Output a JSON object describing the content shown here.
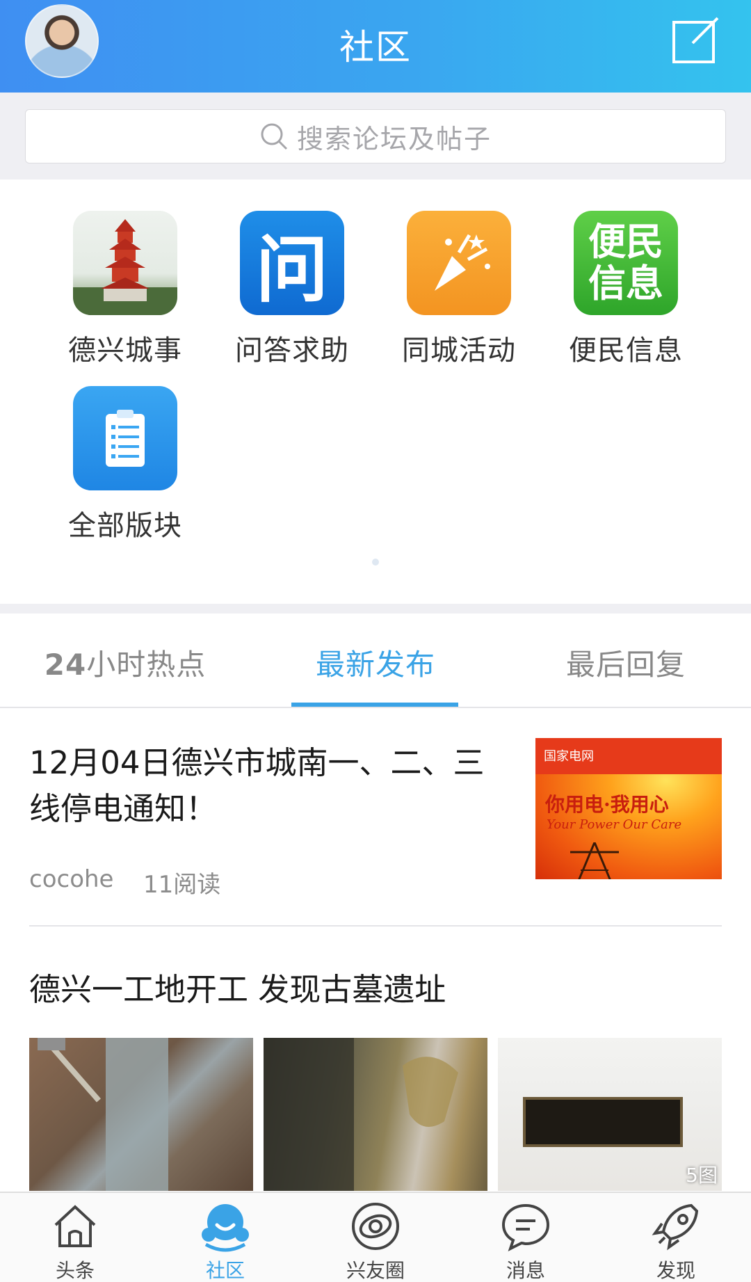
{
  "header": {
    "title": "社区"
  },
  "search": {
    "placeholder": "搜索论坛及帖子"
  },
  "categories": [
    {
      "label": "德兴城事",
      "icon": "pagoda-icon"
    },
    {
      "label": "问答求助",
      "icon": "question-icon",
      "glyph": "问"
    },
    {
      "label": "同城活动",
      "icon": "party-popper-icon"
    },
    {
      "label": "便民信息",
      "icon": "info-icon",
      "glyph_line1": "便民",
      "glyph_line2": "信息"
    },
    {
      "label": "全部版块",
      "icon": "clipboard-list-icon"
    }
  ],
  "tabs": [
    {
      "label_bold": "24",
      "label_rest": "小时热点"
    },
    {
      "label": "最新发布"
    },
    {
      "label": "最后回复"
    }
  ],
  "active_tab": "最新发布",
  "posts": [
    {
      "title_line1": "12月04日德兴市城南一、二、三",
      "title_line2": "线停电通知！",
      "author": "cocohe",
      "reads": "11阅读",
      "thumb": {
        "brand": "国家电网",
        "text": "你用电·我用心",
        "sub": "Your Power  Our Care"
      }
    },
    {
      "title": "德兴一工地开工 发现古墓遗址",
      "image_count": "5图"
    }
  ],
  "bottom_nav": [
    {
      "label": "头条",
      "icon": "home-icon"
    },
    {
      "label": "社区",
      "icon": "community-icon",
      "active": true
    },
    {
      "label": "兴友圈",
      "icon": "orbit-icon"
    },
    {
      "label": "消息",
      "icon": "message-icon"
    },
    {
      "label": "发现",
      "icon": "rocket-icon"
    }
  ],
  "colors": {
    "accent": "#3aa3e6",
    "header_start": "#3f8ff2",
    "header_end": "#34c3ee"
  }
}
